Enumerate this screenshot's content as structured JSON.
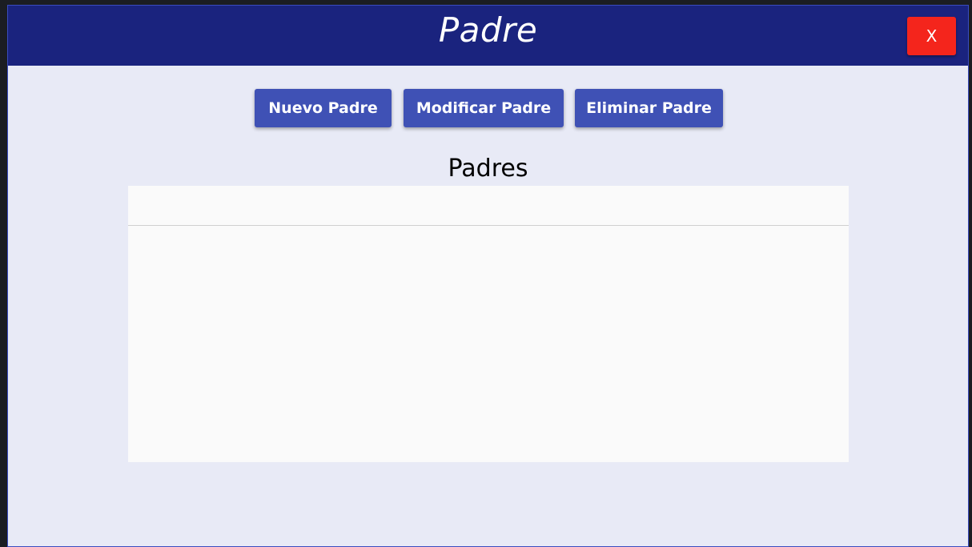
{
  "window": {
    "title": "Padre",
    "close_label": "X"
  },
  "toolbar": {
    "new_label": "Nuevo Padre",
    "modify_label": "Modificar Padre",
    "delete_label": "Eliminar Padre"
  },
  "main": {
    "section_title": "Padres",
    "grid": {
      "columns": [],
      "rows": []
    }
  },
  "colors": {
    "header_bg": "#1a237e",
    "window_bg": "#e8eaf6",
    "button_bg": "#3f51b5",
    "close_bg": "#f4251c",
    "grid_bg": "#fafafa"
  }
}
